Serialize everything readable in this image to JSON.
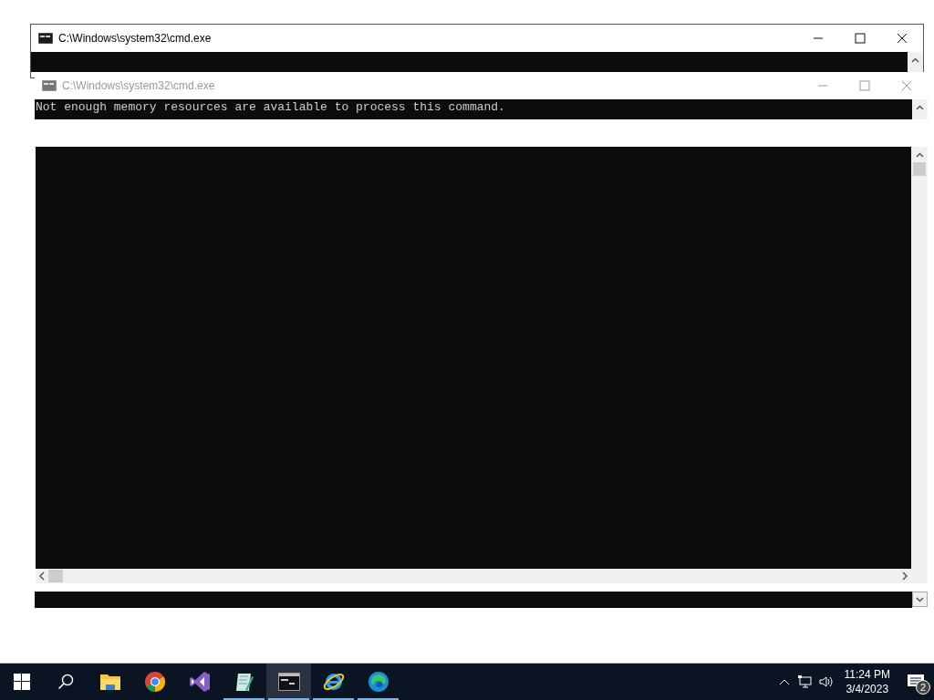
{
  "windows": [
    {
      "title": "C:\\Windows\\system32\\cmd.exe",
      "active": true
    },
    {
      "title": "C:\\Windows\\system32\\cmd.exe",
      "active": false,
      "lines": [
        "Not enough memory resources are available to process this command."
      ]
    }
  ],
  "taskbar": {
    "apps": [
      {
        "kind": "explorer",
        "running": false,
        "selected": false
      },
      {
        "kind": "chrome",
        "running": false,
        "selected": false
      },
      {
        "kind": "studio",
        "running": false,
        "selected": false
      },
      {
        "kind": "notepad",
        "running": true,
        "selected": false
      },
      {
        "kind": "terminal",
        "running": true,
        "selected": true
      },
      {
        "kind": "ie",
        "running": true,
        "selected": false
      },
      {
        "kind": "edge",
        "running": true,
        "selected": false
      }
    ],
    "time": "11:24 PM",
    "date": "3/4/2023",
    "notifications": "2"
  }
}
